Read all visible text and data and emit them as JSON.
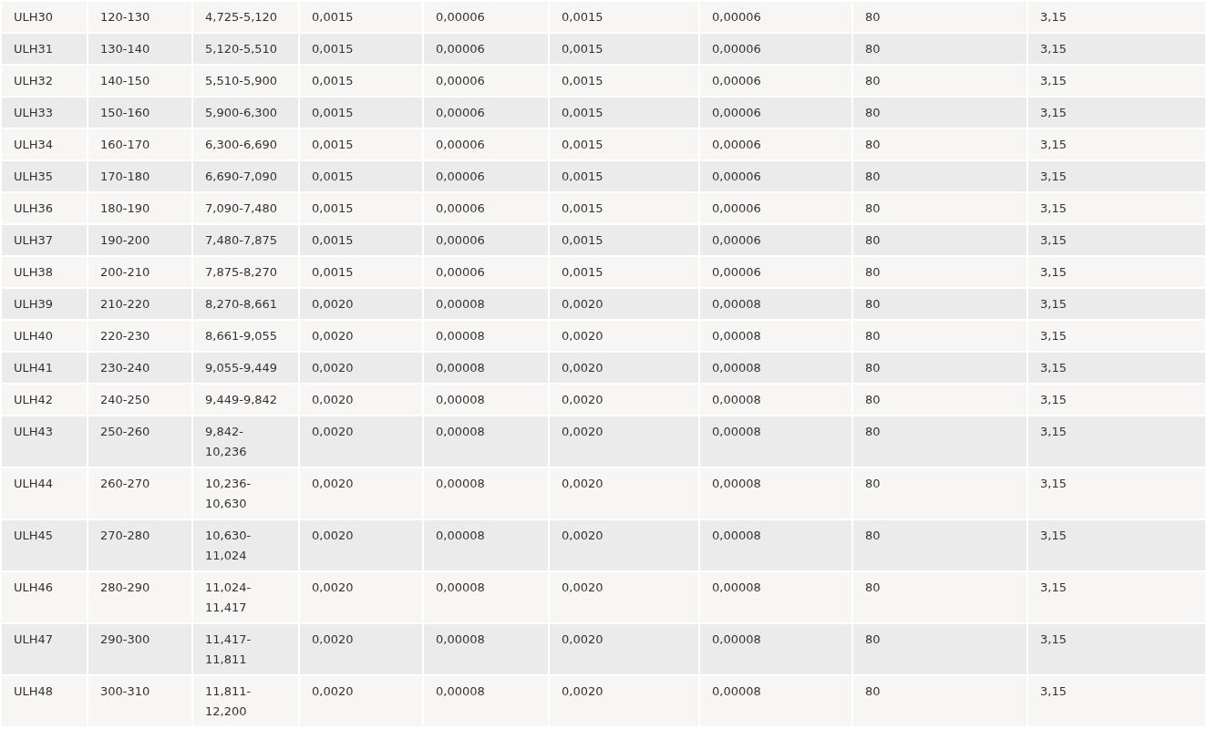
{
  "table": {
    "rows": [
      [
        "ULH30",
        "120-130",
        "4,725-5,120",
        "0,0015",
        "0,00006",
        "0,0015",
        "0,00006",
        "80",
        "3,15"
      ],
      [
        "ULH31",
        "130-140",
        "5,120-5,510",
        "0,0015",
        "0,00006",
        "0,0015",
        "0,00006",
        "80",
        "3,15"
      ],
      [
        "ULH32",
        "140-150",
        "5,510-5,900",
        "0,0015",
        "0,00006",
        "0,0015",
        "0,00006",
        "80",
        "3,15"
      ],
      [
        "ULH33",
        "150-160",
        "5,900-6,300",
        "0,0015",
        "0,00006",
        "0,0015",
        "0,00006",
        "80",
        "3,15"
      ],
      [
        "ULH34",
        "160-170",
        "6,300-6,690",
        "0,0015",
        "0,00006",
        "0,0015",
        "0,00006",
        "80",
        "3,15"
      ],
      [
        "ULH35",
        "170-180",
        "6,690-7,090",
        "0,0015",
        "0,00006",
        "0,0015",
        "0,00006",
        "80",
        "3,15"
      ],
      [
        "ULH36",
        "180-190",
        "7,090-7,480",
        "0,0015",
        "0,00006",
        "0,0015",
        "0,00006",
        "80",
        "3,15"
      ],
      [
        "ULH37",
        "190-200",
        "7,480-7,875",
        "0,0015",
        "0,00006",
        "0,0015",
        "0,00006",
        "80",
        "3,15"
      ],
      [
        "ULH38",
        "200-210",
        "7,875-8,270",
        "0,0015",
        "0,00006",
        "0,0015",
        "0,00006",
        "80",
        "3,15"
      ],
      [
        "ULH39",
        "210-220",
        "8,270-8,661",
        "0,0020",
        "0,00008",
        "0,0020",
        "0,00008",
        "80",
        "3,15"
      ],
      [
        "ULH40",
        "220-230",
        "8,661-9,055",
        "0,0020",
        "0,00008",
        "0,0020",
        "0,00008",
        "80",
        "3,15"
      ],
      [
        "ULH41",
        "230-240",
        "9,055-9,449",
        "0,0020",
        "0,00008",
        "0,0020",
        "0,00008",
        "80",
        "3,15"
      ],
      [
        "ULH42",
        "240-250",
        "9,449-9,842",
        "0,0020",
        "0,00008",
        "0,0020",
        "0,00008",
        "80",
        "3,15"
      ],
      [
        "ULH43",
        "250-260",
        "9,842-10,236",
        "0,0020",
        "0,00008",
        "0,0020",
        "0,00008",
        "80",
        "3,15"
      ],
      [
        "ULH44",
        "260-270",
        "10,236-10,630",
        "0,0020",
        "0,00008",
        "0,0020",
        "0,00008",
        "80",
        "3,15"
      ],
      [
        "ULH45",
        "270-280",
        "10,630-11,024",
        "0,0020",
        "0,00008",
        "0,0020",
        "0,00008",
        "80",
        "3,15"
      ],
      [
        "ULH46",
        "280-290",
        "11,024-11,417",
        "0,0020",
        "0,00008",
        "0,0020",
        "0,00008",
        "80",
        "3,15"
      ],
      [
        "ULH47",
        "290-300",
        "11,417-11,811",
        "0,0020",
        "0,00008",
        "0,0020",
        "0,00008",
        "80",
        "3,15"
      ],
      [
        "ULH48",
        "300-310",
        "11,811-12,200",
        "0,0020",
        "0,00008",
        "0,0020",
        "0,00008",
        "80",
        "3,15"
      ]
    ]
  }
}
